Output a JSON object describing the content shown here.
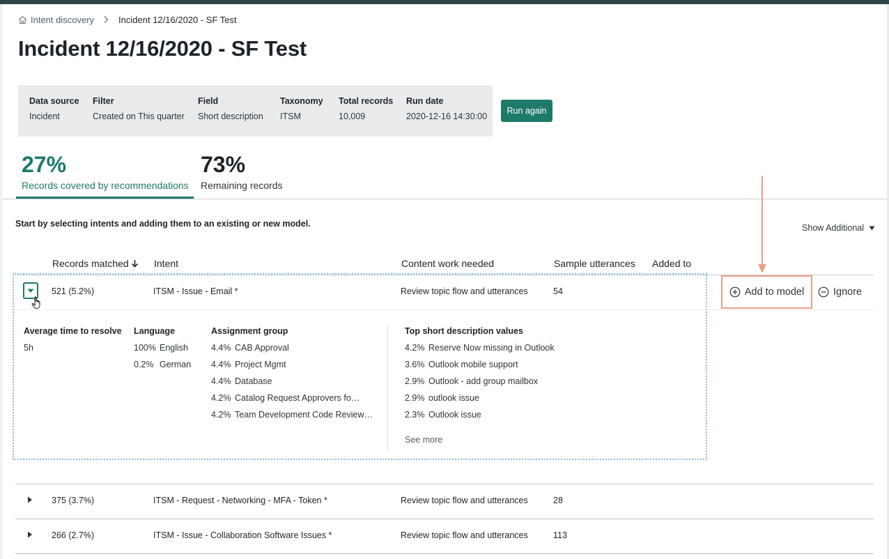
{
  "breadcrumb": {
    "home_label": "Intent discovery",
    "current": "Incident 12/16/2020 - SF Test",
    "home_icon": "home-icon",
    "separator_icon": "chevron-right-icon"
  },
  "page_title": "Incident 12/16/2020 - SF Test",
  "summary": {
    "data_source": {
      "label": "Data source",
      "value": "Incident"
    },
    "filter": {
      "label": "Filter",
      "value": "Created on This quarter"
    },
    "field": {
      "label": "Field",
      "value": "Short description"
    },
    "taxonomy": {
      "label": "Taxonomy",
      "value": "ITSM"
    },
    "total_records": {
      "label": "Total records",
      "value": "10,009"
    },
    "run_date": {
      "label": "Run date",
      "value": "2020-12-16 14:30:00"
    }
  },
  "run_again_label": "Run again",
  "tabs": [
    {
      "value": "27%",
      "label": "Records covered by recommendations",
      "selected": true
    },
    {
      "value": "73%",
      "label": "Remaining records",
      "selected": false
    }
  ],
  "instruction": "Start by selecting intents and adding them to an existing or new model.",
  "show_additional": "Show Additional",
  "columns": {
    "records_matched": "Records matched",
    "intent": "Intent",
    "content_work": "Content work needed",
    "sample_utterances": "Sample utterances",
    "added_to": "Added to"
  },
  "rows": [
    {
      "records": "521 (5.2%)",
      "intent": "ITSM - Issue - Email *",
      "content_work": "Review topic flow and utterances",
      "samples": "54",
      "expanded": true
    },
    {
      "records": "375 (3.7%)",
      "intent": "ITSM - Request - Networking - MFA - Token *",
      "content_work": "Review topic flow and utterances",
      "samples": "28",
      "expanded": false
    },
    {
      "records": "266 (2.7%)",
      "intent": "ITSM - Issue - Collaboration Software Issues *",
      "content_work": "Review topic flow and utterances",
      "samples": "113",
      "expanded": false
    }
  ],
  "details": {
    "avg_time": {
      "label": "Average time to resolve",
      "value": "5h"
    },
    "language": {
      "label": "Language",
      "items": [
        {
          "pct": "100%",
          "name": "English"
        },
        {
          "pct": "0.2%",
          "name": "German"
        }
      ]
    },
    "assignment": {
      "label": "Assignment group",
      "items": [
        {
          "pct": "4.4%",
          "name": "CAB Approval"
        },
        {
          "pct": "4.4%",
          "name": "Project Mgmt"
        },
        {
          "pct": "4.4%",
          "name": "Database"
        },
        {
          "pct": "4.2%",
          "name": "Catalog Request Approvers fo…"
        },
        {
          "pct": "4.2%",
          "name": "Team Development Code Review…"
        }
      ]
    },
    "top_values": {
      "label": "Top short description values",
      "items": [
        {
          "pct": "4.2%",
          "name": "Reserve Now missing in Outlook"
        },
        {
          "pct": "3.6%",
          "name": "Outlook mobile support"
        },
        {
          "pct": "2.9%",
          "name": "Outlook - add group mailbox"
        },
        {
          "pct": "2.9%",
          "name": "outlook issue"
        },
        {
          "pct": "2.3%",
          "name": "Outlook issue"
        }
      ]
    },
    "see_more": "See more"
  },
  "actions": {
    "add_to_model": "Add to model",
    "ignore": "Ignore"
  },
  "colors": {
    "accent": "#1e7a6a",
    "highlight_box": "#e8a08a",
    "selection_border": "#8dbde2"
  }
}
